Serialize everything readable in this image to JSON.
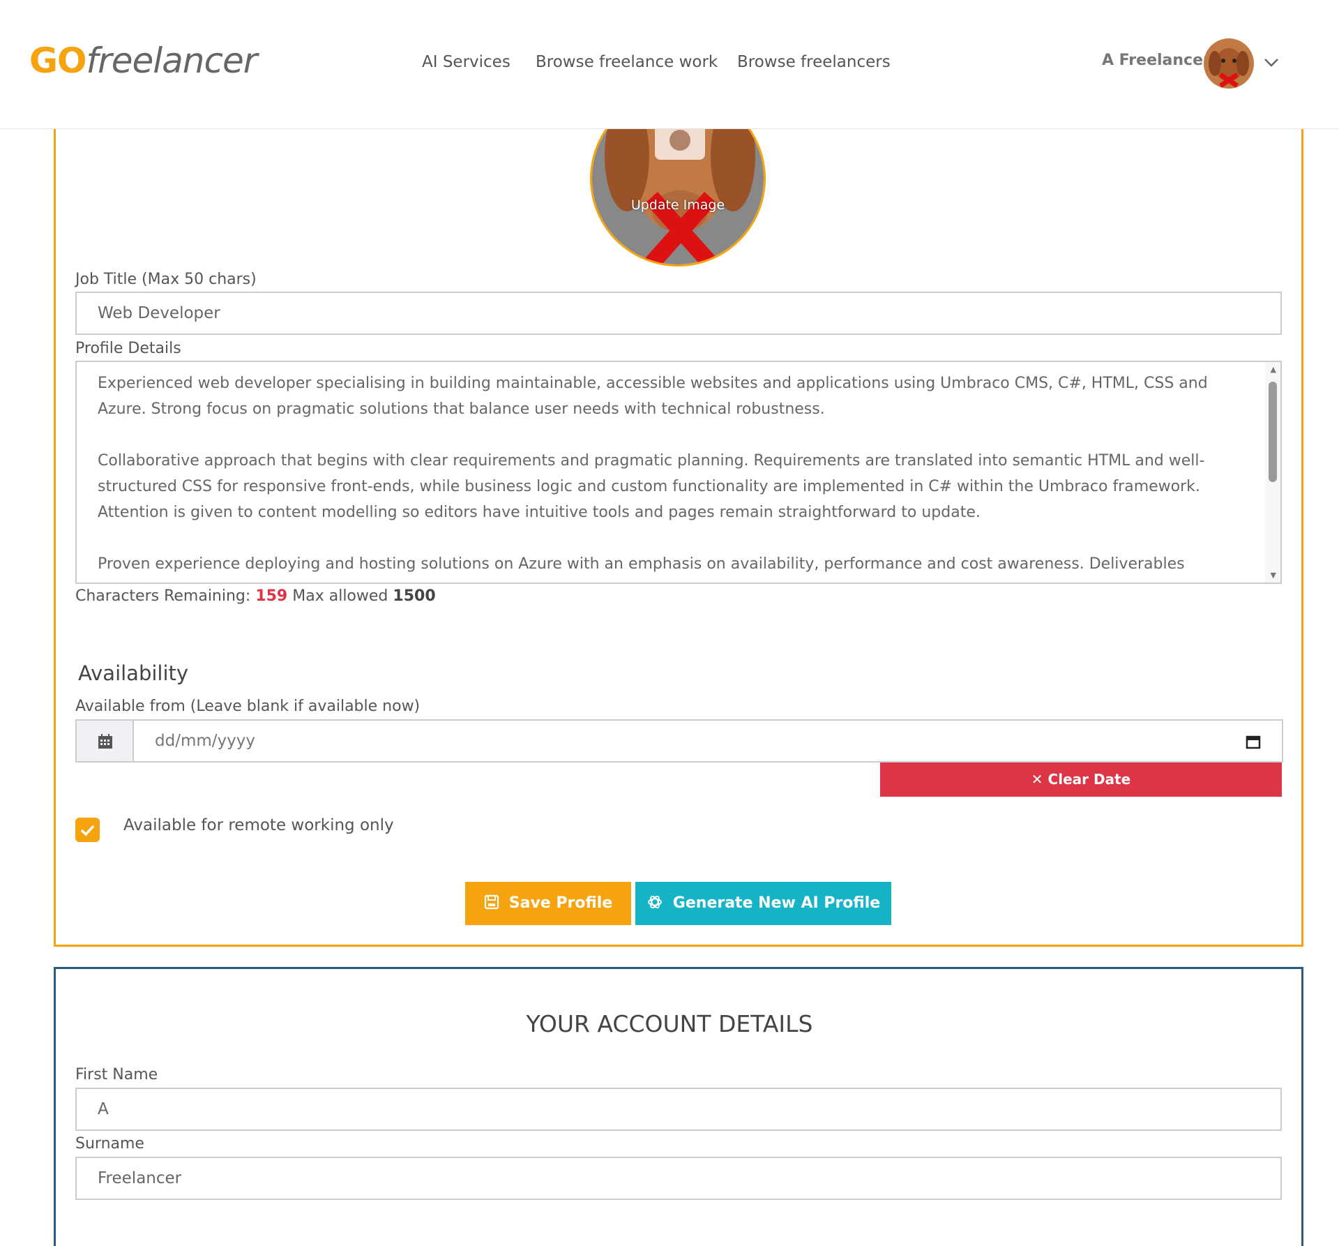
{
  "header": {
    "logo_go": "GO",
    "logo_rest": "freelancer",
    "nav": [
      "AI Services",
      "Browse freelance work",
      "Browse freelancers"
    ],
    "user_name": "A Freelancer"
  },
  "profile": {
    "update_image_label": "Update Image",
    "job_title_label": "Job Title (Max 50 chars)",
    "job_title_value": "Web Developer",
    "details_label": "Profile Details",
    "details_paragraphs": [
      "Experienced web developer specialising in building maintainable, accessible websites and applications using Umbraco CMS, C#, HTML, CSS and Azure. Strong focus on pragmatic solutions that balance user needs with technical robustness.",
      "Collaborative approach that begins with clear requirements and pragmatic planning. Requirements are translated into semantic HTML and well-structured CSS for responsive front-ends, while business logic and custom functionality are implemented in C# within the Umbraco framework. Attention is given to content modelling so editors have intuitive tools and pages remain straightforward to update.",
      "Proven experience deploying and hosting solutions on Azure with an emphasis on availability, performance and cost awareness. Deliverables include clear"
    ],
    "chars_remaining_label": "Characters Remaining:",
    "chars_remaining_value": "159",
    "max_allowed_label": "Max allowed",
    "max_allowed_value": "1500"
  },
  "availability": {
    "heading": "Availability",
    "from_label": "Available from (Leave blank if available now)",
    "date_placeholder": "dd/mm/yyyy",
    "clear_date_label": "Clear Date",
    "remote_label": "Available for remote working only",
    "remote_checked": true
  },
  "actions": {
    "save_label": "Save Profile",
    "generate_label": "Generate New AI Profile"
  },
  "account": {
    "title": "YOUR ACCOUNT DETAILS",
    "first_name_label": "First Name",
    "first_name_value": "A",
    "surname_label": "Surname",
    "surname_value": "Freelancer"
  },
  "colors": {
    "accent": "#f5a30f",
    "danger": "#dc3545",
    "ai_teal": "#17b3c6",
    "account_border": "#2b5b84"
  }
}
